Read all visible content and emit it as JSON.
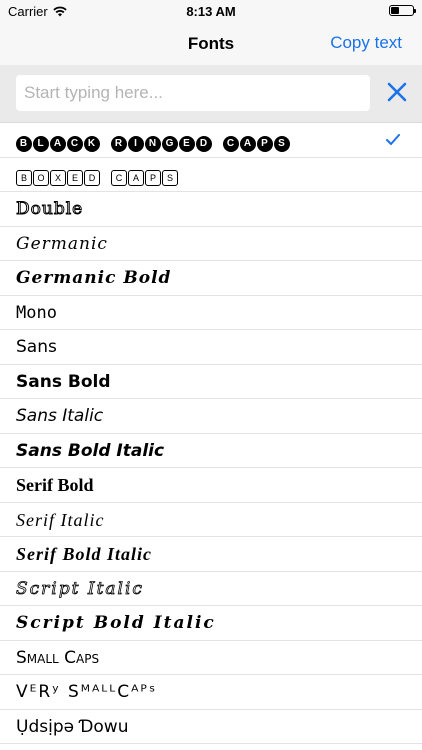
{
  "status_bar": {
    "carrier": "Carrier",
    "time": "8:13 AM",
    "icons": [
      "wifi-icon",
      "battery-icon"
    ]
  },
  "nav": {
    "title": "Fonts",
    "action_label": "Copy text"
  },
  "search": {
    "placeholder": "Start typing here...",
    "value": ""
  },
  "colors": {
    "accent": "#1a73e8",
    "nav_bg": "#f7f7f7",
    "search_bg": "#eaeaea"
  },
  "fonts": [
    {
      "label": "BLACK RINGED CAPS",
      "style": "ringed",
      "selected": true
    },
    {
      "label": "BOXED CAPS",
      "style": "boxed",
      "selected": false
    },
    {
      "label": "Double",
      "style": "double",
      "selected": false
    },
    {
      "label": "Germanic",
      "style": "germanic",
      "selected": false
    },
    {
      "label": "Germanic Bold",
      "style": "germanic-bold",
      "selected": false
    },
    {
      "label": "Mono",
      "style": "mono",
      "selected": false
    },
    {
      "label": "Sans",
      "style": "sans",
      "selected": false
    },
    {
      "label": "Sans Bold",
      "style": "sans-bold",
      "selected": false
    },
    {
      "label": "Sans Italic",
      "style": "sans-italic",
      "selected": false
    },
    {
      "label": "Sans Bold Italic",
      "style": "sans-bold-italic",
      "selected": false
    },
    {
      "label": "Serif Bold",
      "style": "serif-bold",
      "selected": false
    },
    {
      "label": "Serif Italic",
      "style": "serif-italic",
      "selected": false
    },
    {
      "label": "Serif Bold Italic",
      "style": "serif-bold-italic",
      "selected": false
    },
    {
      "label": "Script Italic",
      "style": "script-italic",
      "selected": false
    },
    {
      "label": "Script Bold Italic",
      "style": "script-bold-italic",
      "selected": false
    },
    {
      "label": "Small Caps",
      "style": "small-caps",
      "selected": false
    },
    {
      "label": "VᴱRʸ SᴹᴬᴸᴸCᴬᴾˢ",
      "style": "very-small-caps",
      "selected": false
    },
    {
      "label": "Ụdsịpǝ Ɗowu",
      "style": "upside-down",
      "selected": false
    }
  ]
}
